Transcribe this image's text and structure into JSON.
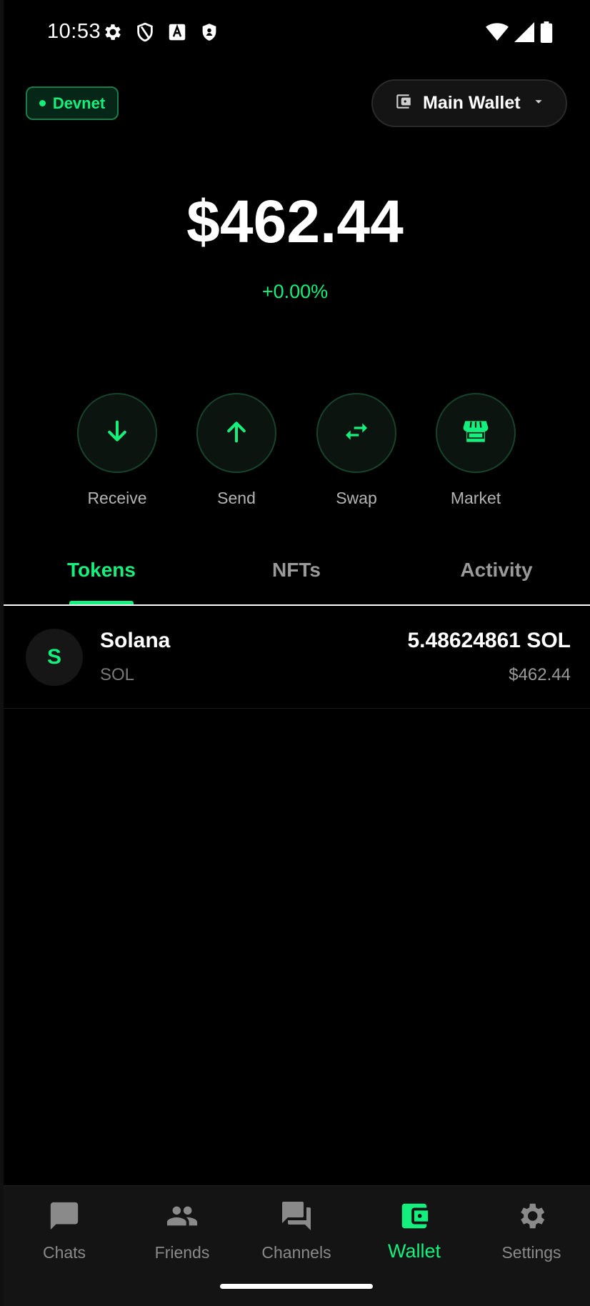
{
  "status_bar": {
    "time": "10:53",
    "left_icons": [
      "gear-icon",
      "shield-outline-icon",
      "text-a-icon",
      "shield-filled-icon"
    ],
    "right_icons": [
      "wifi-icon",
      "cell-signal-icon",
      "battery-icon"
    ]
  },
  "header": {
    "network_badge": "Devnet",
    "wallet_selector": "Main Wallet"
  },
  "balance": {
    "total": "$462.44",
    "change": "+0.00%"
  },
  "actions": [
    {
      "label": "Receive",
      "icon": "arrow-down-icon"
    },
    {
      "label": "Send",
      "icon": "arrow-up-icon"
    },
    {
      "label": "Swap",
      "icon": "swap-icon"
    },
    {
      "label": "Market",
      "icon": "store-icon"
    }
  ],
  "tabs": [
    {
      "label": "Tokens",
      "active": true
    },
    {
      "label": "NFTs",
      "active": false
    },
    {
      "label": "Activity",
      "active": false
    }
  ],
  "tokens": [
    {
      "avatar": "S",
      "name": "Solana",
      "symbol": "SOL",
      "amount": "5.48624861 SOL",
      "value": "$462.44"
    }
  ],
  "bottom_nav": [
    {
      "label": "Chats",
      "icon": "chat-icon",
      "active": false
    },
    {
      "label": "Friends",
      "icon": "people-icon",
      "active": false
    },
    {
      "label": "Channels",
      "icon": "forum-icon",
      "active": false
    },
    {
      "label": "Wallet",
      "icon": "wallet-icon",
      "active": true
    },
    {
      "label": "Settings",
      "icon": "settings-icon",
      "active": false
    }
  ],
  "colors": {
    "accent": "#14f07e",
    "background": "#000000",
    "surface": "#141414",
    "muted_text": "#8a8a8a"
  }
}
